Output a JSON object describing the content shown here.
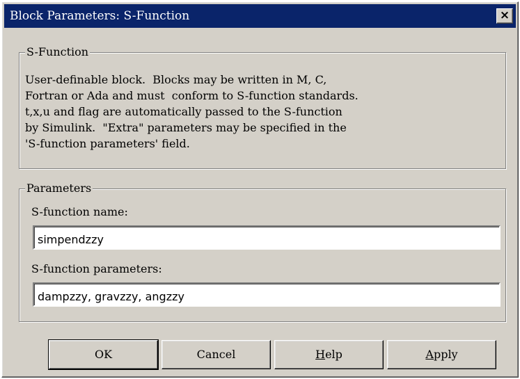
{
  "window": {
    "title": "Block Parameters: S-Function",
    "close_glyph": "×"
  },
  "sfunction_group": {
    "legend": "S-Function",
    "description": "User-definable block.  Blocks may be written in M, C,\nFortran or Ada and must  conform to S-function standards.\nt,x,u and flag are automatically passed to the S-function\nby Simulink.  \"Extra\" parameters may be specified in the\n'S-function parameters' field."
  },
  "parameters_group": {
    "legend": "Parameters",
    "name_label": "S-function name:",
    "name_value": "simpendzzy",
    "params_label": "S-function parameters:",
    "params_value": "dampzzy, gravzzy, angzzy"
  },
  "buttons": {
    "ok": "OK",
    "cancel": "Cancel",
    "help_mnemonic": "H",
    "help_rest": "elp",
    "apply_mnemonic": "A",
    "apply_rest": "pply"
  },
  "colors": {
    "titlebar": "#0a246a",
    "dialog_face": "#d4d0c8"
  }
}
